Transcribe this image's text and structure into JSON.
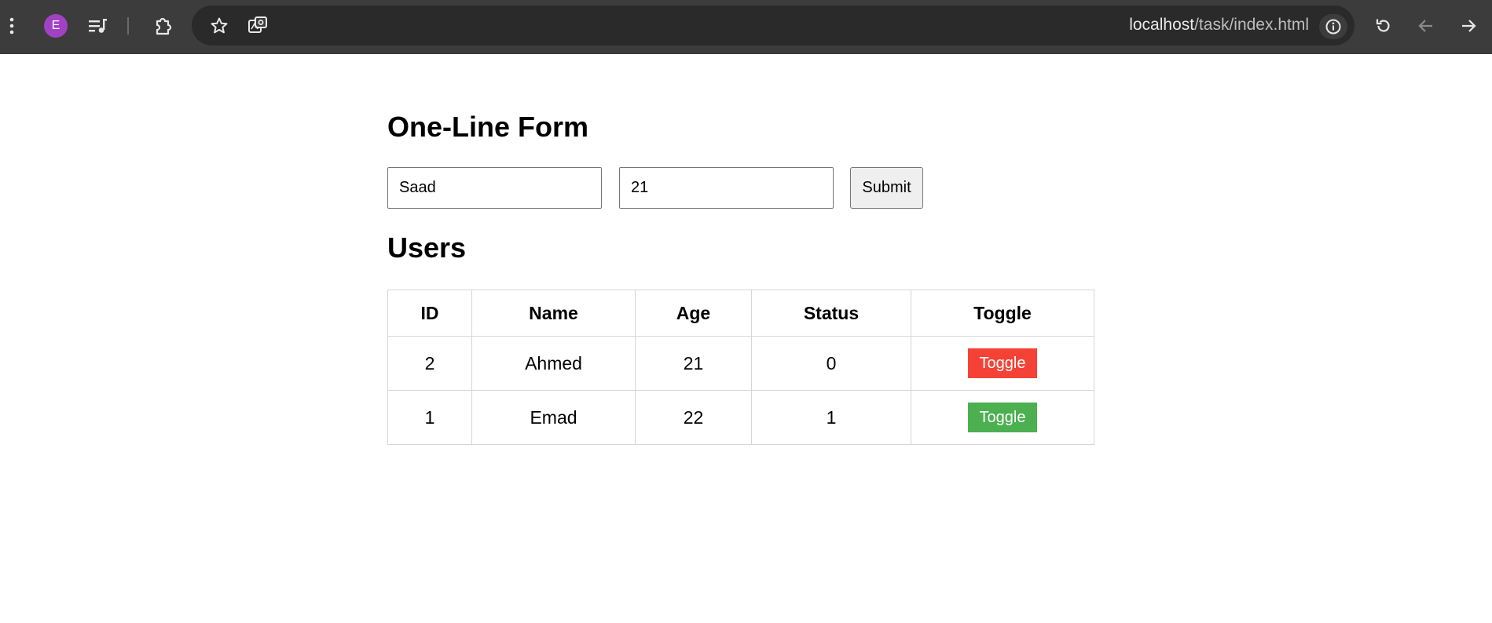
{
  "browser": {
    "profile_initial": "E",
    "url_host": "localhost",
    "url_path": "/task/index.html"
  },
  "colors": {
    "toggle_off": "#f44336",
    "toggle_on": "#4caf50",
    "avatar": "#a142c4"
  },
  "form": {
    "title": "One-Line Form",
    "name_value": "Saad",
    "age_value": "21",
    "submit_label": "Submit"
  },
  "users": {
    "title": "Users",
    "columns": [
      "ID",
      "Name",
      "Age",
      "Status",
      "Toggle"
    ],
    "rows": [
      {
        "id": "2",
        "name": "Ahmed",
        "age": "21",
        "status": "0",
        "toggle_label": "Toggle",
        "toggle_state": "off"
      },
      {
        "id": "1",
        "name": "Emad",
        "age": "22",
        "status": "1",
        "toggle_label": "Toggle",
        "toggle_state": "on"
      }
    ]
  }
}
